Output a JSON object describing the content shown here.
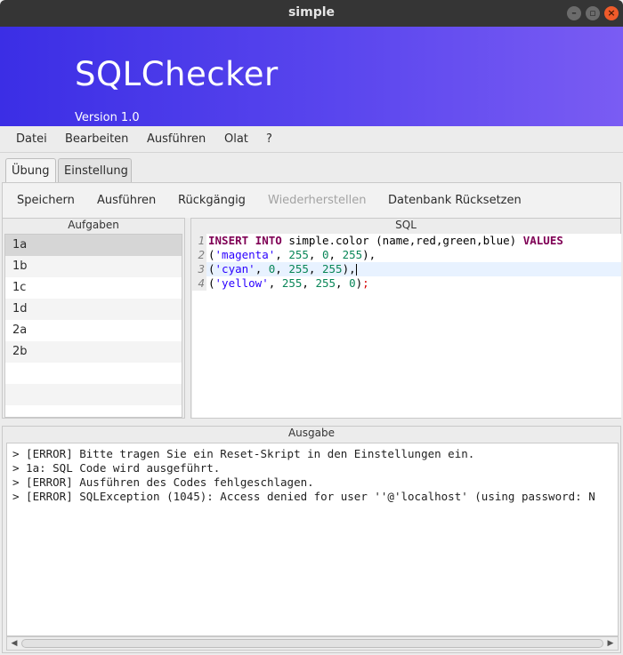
{
  "window": {
    "title": "simple"
  },
  "banner": {
    "app_name": "SQLChecker",
    "version": "Version 1.0"
  },
  "menu": {
    "items": [
      "Datei",
      "Bearbeiten",
      "Ausführen",
      "Olat",
      "?"
    ]
  },
  "tabs": [
    {
      "label": "Übung",
      "active": true
    },
    {
      "label": "Einstellung",
      "active": false
    }
  ],
  "toolbar": {
    "save": "Speichern",
    "run": "Ausführen",
    "undo": "Rückgängig",
    "redo": "Wiederherstellen",
    "reset_db": "Datenbank Rücksetzen"
  },
  "tasks": {
    "header": "Aufgaben",
    "items": [
      "1a",
      "1b",
      "1c",
      "1d",
      "2a",
      "2b"
    ],
    "selected": "1a"
  },
  "sql": {
    "header": "SQL",
    "line_numbers": [
      "1",
      "2",
      "3",
      "4"
    ],
    "lines": [
      "INSERT INTO simple.color (name,red,green,blue) VALUES",
      "('magenta', 255, 0, 255),",
      "('cyan', 0, 255, 255),",
      "('yellow', 255, 255, 0);"
    ]
  },
  "output": {
    "header": "Ausgabe",
    "lines": [
      "> [ERROR] Bitte tragen Sie ein Reset-Skript in den Einstellungen ein.",
      "> 1a: SQL Code wird ausgeführt.",
      "> [ERROR] Ausführen des Codes fehlgeschlagen.",
      "> [ERROR] SQLException (1045): Access denied for user ''@'localhost' (using password: N"
    ]
  },
  "colors": {
    "banner_start": "#3b2ee5",
    "banner_end": "#7a5cf3",
    "keyword": "#7f0055",
    "string": "#2a00ff",
    "number": "#098658",
    "close_button": "#ef5b2a"
  }
}
